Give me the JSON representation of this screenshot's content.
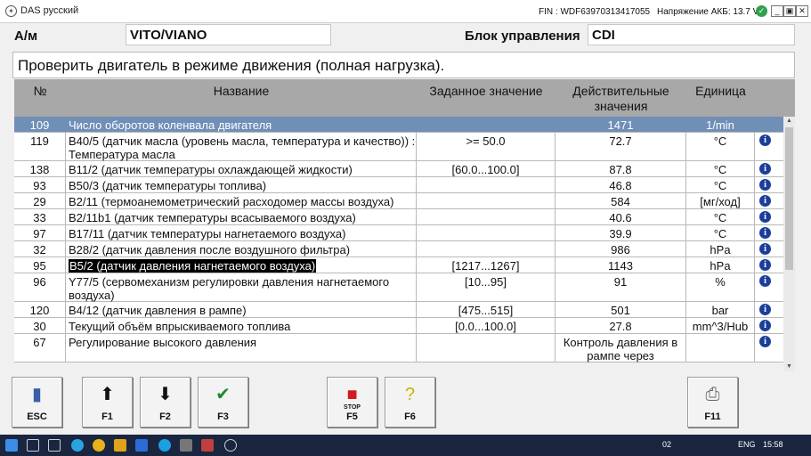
{
  "window": {
    "title": "DAS русский",
    "logo_glyph": "✦",
    "fin": "FIN : WDF63970313417055",
    "battery": "Напряжение АКБ: 13.7 V",
    "battery_ok_glyph": "✓",
    "buttons": {
      "min": "_",
      "restore": "▣",
      "close": "✕"
    }
  },
  "header": {
    "vehicle_label": "А/м",
    "vehicle_value": "VITO/VIANO",
    "ecu_label": "Блок управления",
    "ecu_value": "CDI"
  },
  "instruction": "Проверить двигатель в режиме движения (полная нагрузка).",
  "table": {
    "columns": {
      "num": "№",
      "name": "Название",
      "spec": "Заданное значение",
      "actual": "Действительные значения",
      "unit": "Единица"
    },
    "rows": [
      {
        "num": "109",
        "name": "Число оборотов коленвала двигателя",
        "spec": "",
        "actual": "1471",
        "unit": "1/min",
        "info": false,
        "selected": true
      },
      {
        "num": "119",
        "name": "B40/5 (датчик масла (уровень масла, температура и качество)) : Температура масла",
        "spec": ">= 50.0",
        "actual": "72.7",
        "unit": "°C",
        "info": true
      },
      {
        "num": "138",
        "name": "B11/2 (датчик температуры охлаждающей жидкости)",
        "spec": "[60.0...100.0]",
        "actual": "87.8",
        "unit": "°C",
        "info": true
      },
      {
        "num": "93",
        "name": "B50/3 (датчик температуры топлива)",
        "spec": "",
        "actual": "46.8",
        "unit": "°C",
        "info": true
      },
      {
        "num": "29",
        "name": "B2/11 (термоанемометрический расходомер массы воздуха)",
        "spec": "",
        "actual": "584",
        "unit": "[мг/ход]",
        "info": true
      },
      {
        "num": "33",
        "name": "B2/11b1 (датчик температуры всасываемого воздуха)",
        "spec": "",
        "actual": "40.6",
        "unit": "°C",
        "info": true
      },
      {
        "num": "97",
        "name": "B17/11 (датчик температуры нагнетаемого воздуха)",
        "spec": "",
        "actual": "39.9",
        "unit": "°C",
        "info": true
      },
      {
        "num": "32",
        "name": "B28/2 (датчик давления после воздушного фильтра)",
        "spec": "",
        "actual": "986",
        "unit": "hPa",
        "info": true
      },
      {
        "num": "95",
        "name": "B5/2 (датчик давления нагнетаемого воздуха)",
        "spec": "[1217...1267]",
        "actual": "1143",
        "unit": "hPa",
        "info": true,
        "highlight": true
      },
      {
        "num": "96",
        "name": "Y77/5 (сервомеханизм регулировки давления нагнетаемого воздуха)",
        "spec": "[10...95]",
        "actual": "91",
        "unit": "%",
        "info": true
      },
      {
        "num": "120",
        "name": "B4/12 (датчик давления в рампе)",
        "spec": "[475...515]",
        "actual": "501",
        "unit": "bar",
        "info": true
      },
      {
        "num": "30",
        "name": "Текущий объём впрыскиваемого топлива",
        "spec": "[0.0...100.0]",
        "actual": "27.8",
        "unit": "mm^3/Hub",
        "info": true
      },
      {
        "num": "67",
        "name": "Регулирование высокого давления",
        "spec": "",
        "actual": "Контроль давления в рампе через",
        "unit": "",
        "info": true
      }
    ]
  },
  "info_glyph": "i",
  "scroll": {
    "up": "▲",
    "down": "▼"
  },
  "fkeys": [
    {
      "label": "ESC",
      "icon": "door-exit-icon",
      "glyph": "▮",
      "color": "#3a5fa8"
    },
    {
      "label": "F1",
      "icon": "arrow-up-icon",
      "glyph": "⬆",
      "color": "#111"
    },
    {
      "label": "F2",
      "icon": "arrow-down-icon",
      "glyph": "⬇",
      "color": "#111"
    },
    {
      "label": "F3",
      "icon": "checkmark-icon",
      "glyph": "✔",
      "color": "#1e8a2e"
    },
    {
      "label": "F5",
      "icon": "stop-icon",
      "glyph": "■",
      "color": "#d41a1a",
      "caption": "STOP"
    },
    {
      "label": "F6",
      "icon": "help-icon",
      "glyph": "?",
      "color": "#c9b300"
    },
    {
      "label": "F11",
      "icon": "printer-icon",
      "glyph": "⎙",
      "color": "#666"
    }
  ],
  "taskbar": {
    "lang": "ENG",
    "time": "15:58",
    "counter": "02"
  }
}
